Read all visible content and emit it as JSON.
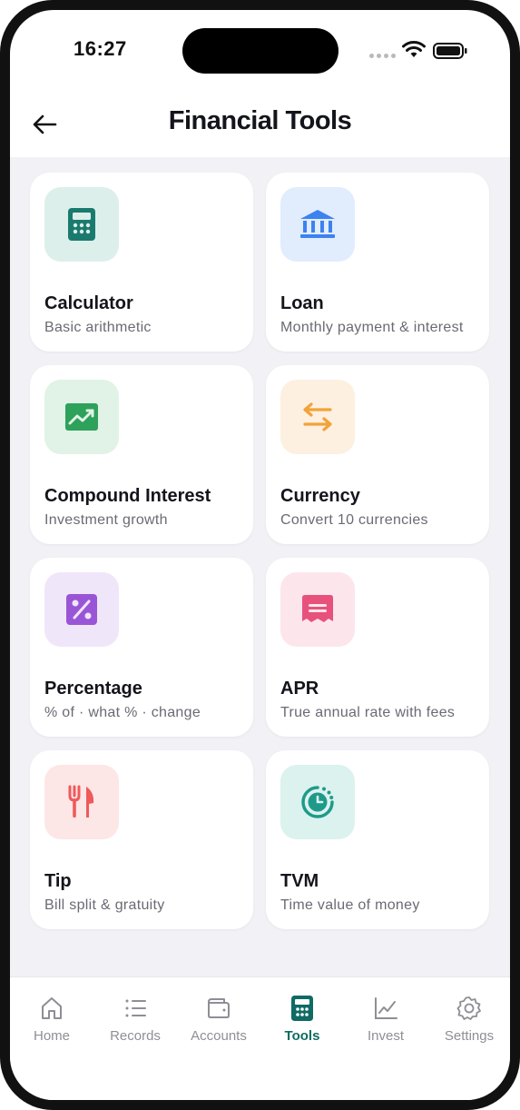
{
  "status_bar": {
    "time": "16:27"
  },
  "header": {
    "title": "Financial Tools",
    "back_icon": "arrow-left-icon"
  },
  "tools": [
    {
      "id": "calculator",
      "title": "Calculator",
      "subtitle": "Basic arithmetic",
      "icon": "calculator-icon",
      "icon_color": "#1b7a6e",
      "bg_color": "#dcefeb"
    },
    {
      "id": "loan",
      "title": "Loan",
      "subtitle": "Monthly payment & interest",
      "icon": "bank-icon",
      "icon_color": "#3c82f0",
      "bg_color": "#e1ecfd"
    },
    {
      "id": "compound",
      "title": "Compound Interest",
      "subtitle": "Investment growth",
      "icon": "chart-growth-icon",
      "icon_color": "#2ea15a",
      "bg_color": "#e0f3e6"
    },
    {
      "id": "currency",
      "title": "Currency",
      "subtitle": "Convert 10 currencies",
      "icon": "swap-arrows-icon",
      "icon_color": "#f2a23a",
      "bg_color": "#fdf0e0"
    },
    {
      "id": "percentage",
      "title": "Percentage",
      "subtitle": "% of · what % · change",
      "icon": "percent-icon",
      "icon_color": "#9a55d6",
      "bg_color": "#f0e6fa"
    },
    {
      "id": "apr",
      "title": "APR",
      "subtitle": "True annual rate with fees",
      "icon": "receipt-icon",
      "icon_color": "#e8517c",
      "bg_color": "#fce6ec"
    },
    {
      "id": "tip",
      "title": "Tip",
      "subtitle": "Bill split & gratuity",
      "icon": "fork-knife-icon",
      "icon_color": "#ef5a5a",
      "bg_color": "#fde6e6"
    },
    {
      "id": "tvm",
      "title": "TVM",
      "subtitle": "Time value of money",
      "icon": "clock-icon",
      "icon_color": "#1f9a8a",
      "bg_color": "#dcf2ef"
    }
  ],
  "tabbar": {
    "items": [
      {
        "label": "Home",
        "icon": "home-icon"
      },
      {
        "label": "Records",
        "icon": "list-icon"
      },
      {
        "label": "Accounts",
        "icon": "wallet-icon"
      },
      {
        "label": "Tools",
        "icon": "calculator-icon",
        "active": true
      },
      {
        "label": "Invest",
        "icon": "chart-line-icon"
      },
      {
        "label": "Settings",
        "icon": "gear-icon"
      }
    ],
    "active_color": "#0f6b63",
    "inactive_color": "#8e8e96"
  }
}
